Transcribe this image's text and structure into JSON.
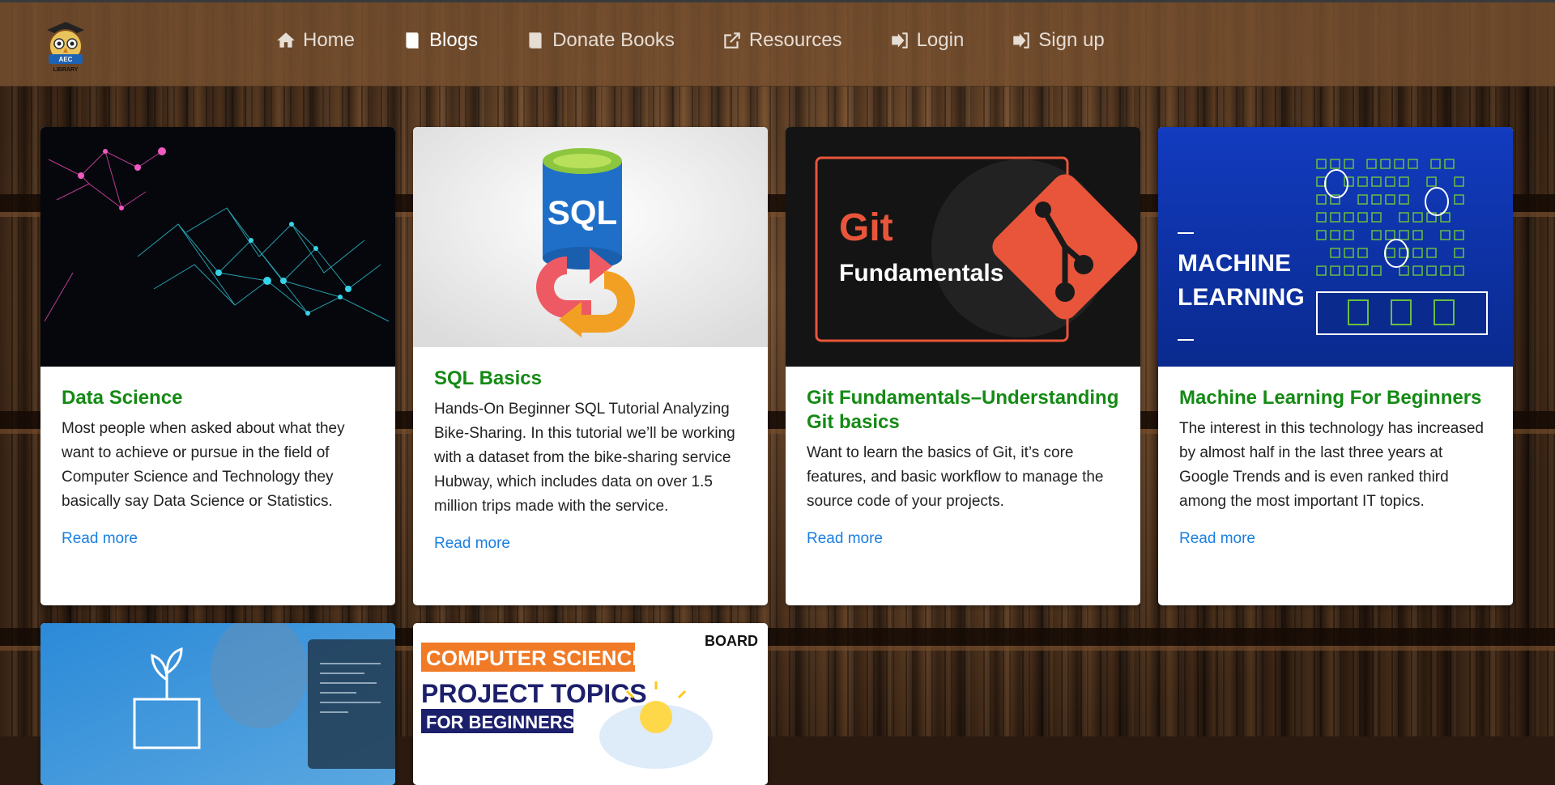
{
  "brand": {
    "logo_lines": [
      "AEC",
      "LIBRARY"
    ]
  },
  "nav": {
    "items": [
      {
        "label": "Home",
        "icon": "home-icon"
      },
      {
        "label": "Blogs",
        "icon": "book-icon",
        "active": true
      },
      {
        "label": "Donate Books",
        "icon": "book-icon"
      },
      {
        "label": "Resources",
        "icon": "external-link-icon"
      },
      {
        "label": "Login",
        "icon": "sign-in-icon"
      },
      {
        "label": "Sign up",
        "icon": "sign-in-icon"
      }
    ]
  },
  "cards": [
    {
      "title": "Data Science",
      "text": "Most people when asked about what they want to achieve or pursue in the field of Computer Science and Technology they basically say Data Science or Statistics.",
      "link": "Read more"
    },
    {
      "title": "SQL Basics",
      "text": "Hands-On Beginner SQL Tutorial Analyzing Bike-Sharing. In this tutorial we’ll be working with a dataset from the bike-sharing service Hubway, which includes data on over 1.5 million trips made with the service.",
      "link": "Read more",
      "image_text": "SQL"
    },
    {
      "title": "Git Fundamentals–Understanding Git basics",
      "text": "Want to learn the basics of Git, it’s core features, and basic workflow to manage the source code of your projects.",
      "link": "Read more",
      "image_text": {
        "line1": "Git",
        "line2": "Fundamentals"
      }
    },
    {
      "title": "Machine Learning For Beginners",
      "text": "The interest in this technology has increased by almost half in the last three years at Google Trends and is even ranked third among the most important IT topics.",
      "link": "Read more",
      "image_text": {
        "line1": "MACHINE",
        "line2": "LEARNING"
      }
    },
    {
      "title": "",
      "text": "",
      "link": ""
    },
    {
      "title": "",
      "text": "",
      "link": "",
      "image_text": {
        "line1": "COMPUTER SCIENCE",
        "line2": "PROJECT TOPICS",
        "line3": "FOR BEGINNERS",
        "brand": "BOARD"
      }
    }
  ],
  "colors": {
    "navbar": "#7a5030",
    "title_green": "#148a14",
    "link_blue": "#1a7fe0"
  }
}
